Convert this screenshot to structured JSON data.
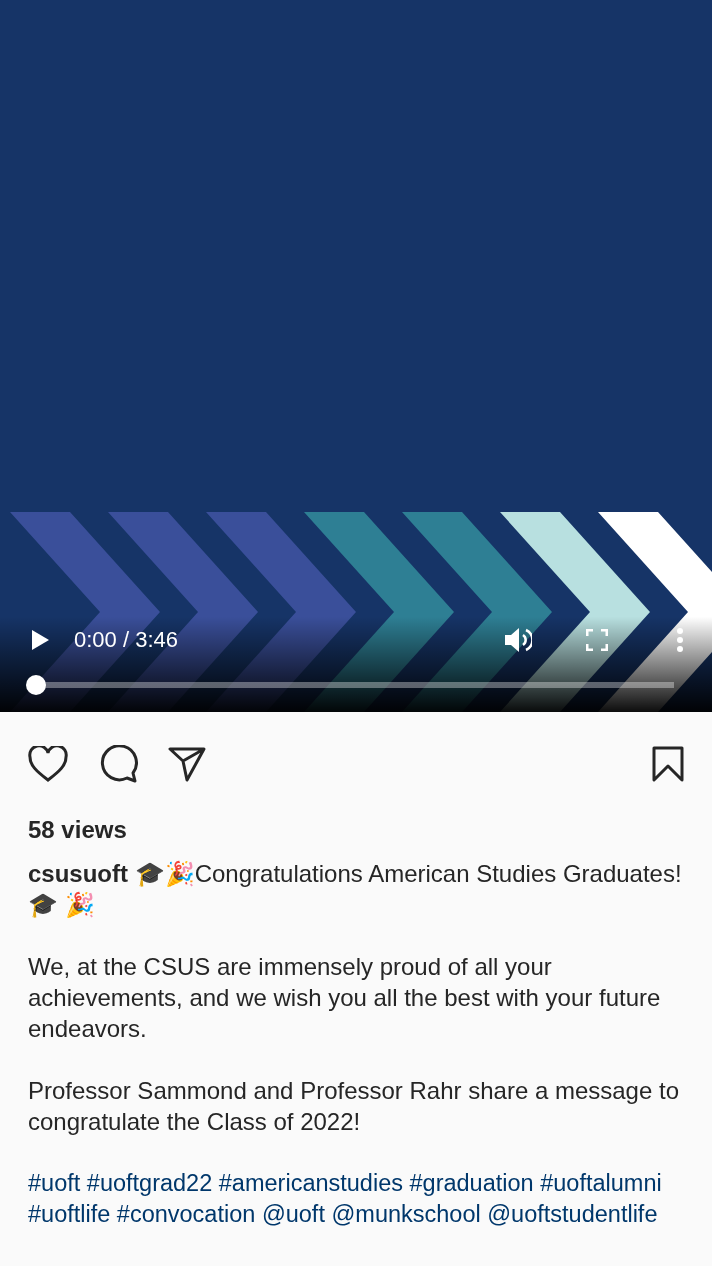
{
  "video": {
    "kind": "picture",
    "playing": false,
    "time": "0:00 / 3:46",
    "progress": {
      "level": 0.01
    }
  },
  "actions": {
    "liked": false,
    "saved": false
  },
  "views": "58 views",
  "caption": {
    "username": "csusuoft",
    "headline": "🎓🎉Congratulations American Studies Graduates! 🎓 🎉",
    "paragraphs": [
      "We, at the CSUS are immensely proud of all your achievements, and we wish you all the best with your future endeavors.",
      "Professor Sammond and Professor Rahr share a message to congratulate the Class of 2022!"
    ],
    "tags": [
      "#uoft",
      "#uoftgrad22",
      "#americanstudies",
      "#graduation",
      "#uoftalumni",
      "#uoftlife",
      "#convocation",
      "@uoft",
      "@munkschool",
      "@uoftstudentlife"
    ]
  }
}
